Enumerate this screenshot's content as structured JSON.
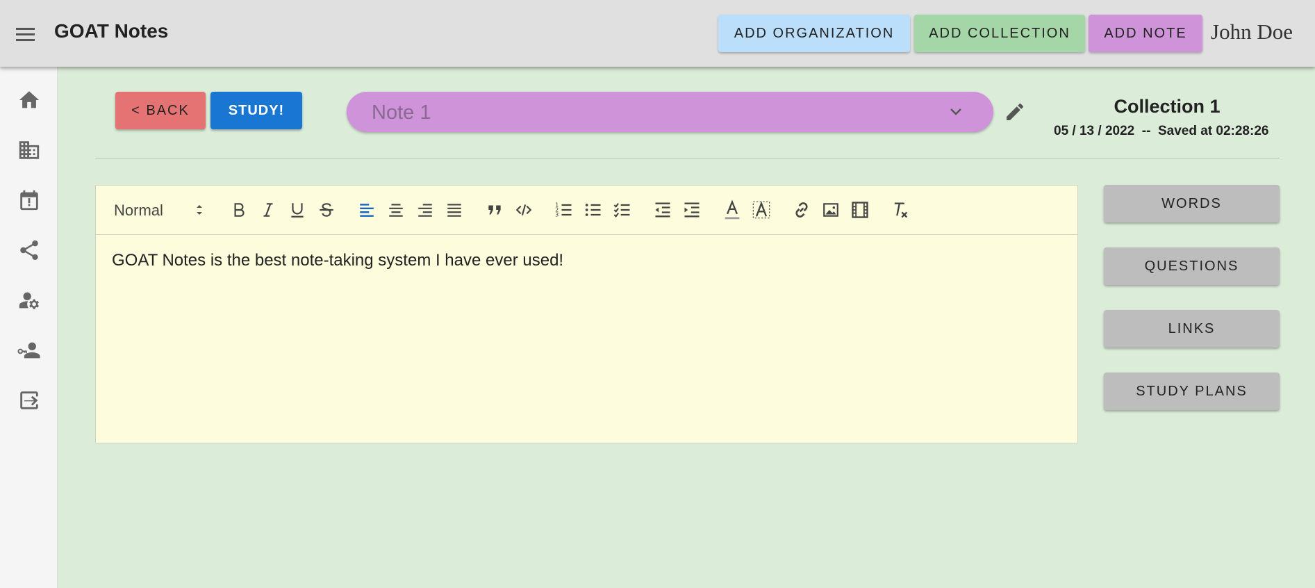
{
  "app": {
    "title": "GOAT Notes",
    "user_name": "John Doe"
  },
  "toolbar_top": {
    "add_organization": "ADD ORGANIZATION",
    "add_collection": "ADD COLLECTION",
    "add_note": "ADD NOTE"
  },
  "sidebar": {
    "icons": [
      "home-icon",
      "organizations-icon",
      "calendar-alert-icon",
      "share-icon",
      "manage-accounts-icon",
      "person-key-icon",
      "logout-icon"
    ]
  },
  "header": {
    "back_label": "< BACK",
    "study_label": "STUDY!",
    "note_selected": "Note 1",
    "collection_title": "Collection 1",
    "date_saved": "05 / 13 / 2022  --  Saved at 02:28:26"
  },
  "editor": {
    "format_value": "Normal",
    "content": "GOAT Notes is the best note-taking system I have ever used!"
  },
  "right_panel": {
    "words": "WORDS",
    "questions": "QUESTIONS",
    "links": "LINKS",
    "study_plans": "STUDY PLANS"
  },
  "colors": {
    "background": "#dbecd9",
    "appbar": "#e0e0e0",
    "add_organization": "#bbdefb",
    "add_collection": "#a5d6a7",
    "add_note": "#ce93d8",
    "back": "#e57373",
    "study": "#1976d2",
    "editor_bg": "#fdfddd",
    "active_align": "#1565c0"
  }
}
